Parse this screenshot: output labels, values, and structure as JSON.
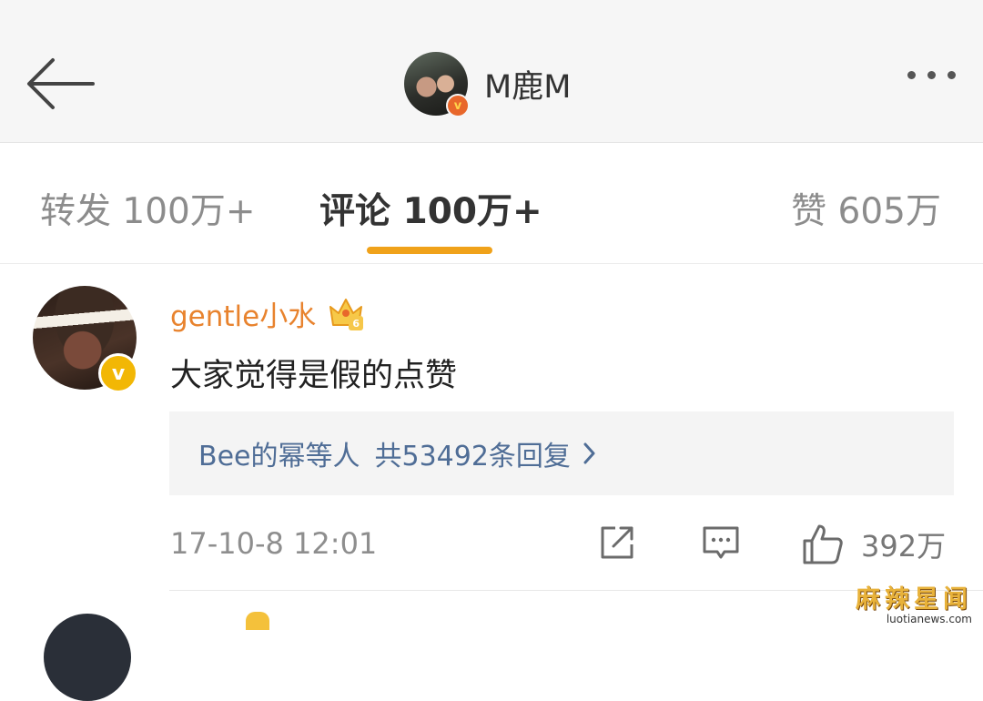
{
  "header": {
    "profile_name": "M鹿M",
    "verified_badge": "v"
  },
  "tabs": [
    {
      "label": "转发 100万+",
      "active": false
    },
    {
      "label": "评论 100万+",
      "active": true
    },
    {
      "label": "赞 605万",
      "active": false
    }
  ],
  "comment": {
    "username": "gentle小水",
    "crown_level": "6",
    "verified_badge": "v",
    "text": "大家觉得是假的点赞",
    "replies": {
      "users": "Bee的幂等人",
      "count_text": "共53492条回复"
    },
    "time": "17-10-8 12:01",
    "likes": "392万"
  },
  "watermark": {
    "title": "麻辣星闻",
    "url": "luotianews.com"
  },
  "colors": {
    "accent": "#f0a21a",
    "username": "#e8832e",
    "link": "#4f6d96",
    "verified": "#f2b705"
  },
  "icons": [
    "back-arrow-icon",
    "more-icon",
    "crown-icon",
    "chevron-right-icon",
    "share-icon",
    "comment-icon",
    "like-icon"
  ]
}
